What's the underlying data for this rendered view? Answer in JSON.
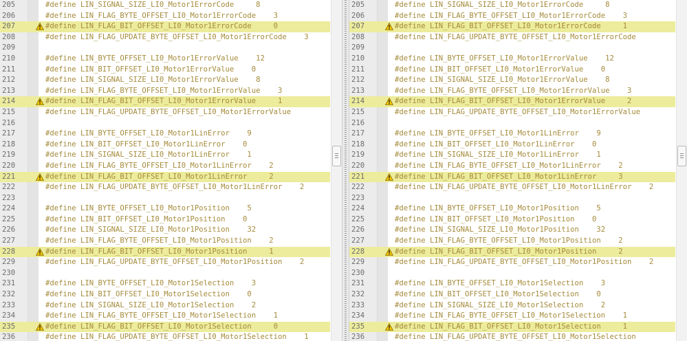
{
  "colors": {
    "changed_bg": "#ecec9c",
    "code": "#a58b3b",
    "line_number": "#6d6d6d",
    "gutter": "#ececec"
  },
  "icons": {
    "change_marker": "warning-icon"
  },
  "left": {
    "lines": [
      {
        "num": "205",
        "code": "#define LIN_SIGNAL_SIZE_LI0_Motor1ErrorCode     8",
        "changed": false
      },
      {
        "num": "206",
        "code": "#define LIN_FLAG_BYTE_OFFSET_LI0_Motor1ErrorCode    3",
        "changed": false
      },
      {
        "num": "207",
        "code": "#define LIN_FLAG_BIT_OFFSET_LI0_Motor1ErrorCode     0",
        "changed": true
      },
      {
        "num": "208",
        "code": "#define LIN_FLAG_UPDATE_BYTE_OFFSET_LI0_Motor1ErrorCode    3",
        "changed": false
      },
      {
        "num": "209",
        "code": "",
        "changed": false
      },
      {
        "num": "210",
        "code": "#define LIN_BYTE_OFFSET_LI0_Motor1ErrorValue    12",
        "changed": false
      },
      {
        "num": "211",
        "code": "#define LIN_BIT_OFFSET_LI0_Motor1ErrorValue    0",
        "changed": false
      },
      {
        "num": "212",
        "code": "#define LIN_SIGNAL_SIZE_LI0_Motor1ErrorValue    8",
        "changed": false
      },
      {
        "num": "213",
        "code": "#define LIN_FLAG_BYTE_OFFSET_LI0_Motor1ErrorValue    3",
        "changed": false
      },
      {
        "num": "214",
        "code": "#define LIN_FLAG_BIT_OFFSET_LI0_Motor1ErrorValue     1",
        "changed": true
      },
      {
        "num": "215",
        "code": "#define LIN_FLAG_UPDATE_BYTE_OFFSET_LI0_Motor1ErrorValue",
        "changed": false
      },
      {
        "num": "216",
        "code": "",
        "changed": false
      },
      {
        "num": "217",
        "code": "#define LIN_BYTE_OFFSET_LI0_Motor1LinError    9",
        "changed": false
      },
      {
        "num": "218",
        "code": "#define LIN_BIT_OFFSET_LI0_Motor1LinError    0",
        "changed": false
      },
      {
        "num": "219",
        "code": "#define LIN_SIGNAL_SIZE_LI0_Motor1LinError    1",
        "changed": false
      },
      {
        "num": "220",
        "code": "#define LIN_FLAG_BYTE_OFFSET_LI0_Motor1LinError    2",
        "changed": false
      },
      {
        "num": "221",
        "code": "#define LIN_FLAG_BIT_OFFSET_LI0_Motor1LinError     2",
        "changed": true
      },
      {
        "num": "222",
        "code": "#define LIN_FLAG_UPDATE_BYTE_OFFSET_LI0_Motor1LinError    2",
        "changed": false
      },
      {
        "num": "223",
        "code": "",
        "changed": false
      },
      {
        "num": "224",
        "code": "#define LIN_BYTE_OFFSET_LI0_Motor1Position    5",
        "changed": false
      },
      {
        "num": "225",
        "code": "#define LIN_BIT_OFFSET_LI0_Motor1Position    0",
        "changed": false
      },
      {
        "num": "226",
        "code": "#define LIN_SIGNAL_SIZE_LI0_Motor1Position    32",
        "changed": false
      },
      {
        "num": "227",
        "code": "#define LIN_FLAG_BYTE_OFFSET_LI0_Motor1Position    2",
        "changed": false
      },
      {
        "num": "228",
        "code": "#define LIN_FLAG_BIT_OFFSET_LI0_Motor1Position     1",
        "changed": true
      },
      {
        "num": "229",
        "code": "#define LIN_FLAG_UPDATE_BYTE_OFFSET_LI0_Motor1Position    2",
        "changed": false
      },
      {
        "num": "230",
        "code": "",
        "changed": false
      },
      {
        "num": "231",
        "code": "#define LIN_BYTE_OFFSET_LI0_Motor1Selection    3",
        "changed": false
      },
      {
        "num": "232",
        "code": "#define LIN_BIT_OFFSET_LI0_Motor1Selection    0",
        "changed": false
      },
      {
        "num": "233",
        "code": "#define LIN_SIGNAL_SIZE_LI0_Motor1Selection    2",
        "changed": false
      },
      {
        "num": "234",
        "code": "#define LIN_FLAG_BYTE_OFFSET_LI0_Motor1Selection    1",
        "changed": false
      },
      {
        "num": "235",
        "code": "#define LIN_FLAG_BIT_OFFSET_LI0_Motor1Selection     0",
        "changed": true
      },
      {
        "num": "236",
        "code": "#define LIN_FLAG_UPDATE_BYTE_OFFSET_LI0_Motor1Selection    1",
        "changed": false
      }
    ]
  },
  "right": {
    "lines": [
      {
        "num": "205",
        "code": "#define LIN_SIGNAL_SIZE_LI0_Motor1ErrorCode     8",
        "changed": false
      },
      {
        "num": "206",
        "code": "#define LIN_FLAG_BYTE_OFFSET_LI0_Motor1ErrorCode    3",
        "changed": false
      },
      {
        "num": "207",
        "code": "#define LIN_FLAG_BIT_OFFSET_LI0_Motor1ErrorCode     1",
        "changed": true
      },
      {
        "num": "208",
        "code": "#define LIN_FLAG_UPDATE_BYTE_OFFSET_LI0_Motor1ErrorCode",
        "changed": false
      },
      {
        "num": "209",
        "code": "",
        "changed": false
      },
      {
        "num": "210",
        "code": "#define LIN_BYTE_OFFSET_LI0_Motor1ErrorValue    12",
        "changed": false
      },
      {
        "num": "211",
        "code": "#define LIN_BIT_OFFSET_LI0_Motor1ErrorValue    0",
        "changed": false
      },
      {
        "num": "212",
        "code": "#define LIN_SIGNAL_SIZE_LI0_Motor1ErrorValue    8",
        "changed": false
      },
      {
        "num": "213",
        "code": "#define LIN_FLAG_BYTE_OFFSET_LI0_Motor1ErrorValue    3",
        "changed": false
      },
      {
        "num": "214",
        "code": "#define LIN_FLAG_BIT_OFFSET_LI0_Motor1ErrorValue     2",
        "changed": true
      },
      {
        "num": "215",
        "code": "#define LIN_FLAG_UPDATE_BYTE_OFFSET_LI0_Motor1ErrorValue",
        "changed": false
      },
      {
        "num": "216",
        "code": "",
        "changed": false
      },
      {
        "num": "217",
        "code": "#define LIN_BYTE_OFFSET_LI0_Motor1LinError    9",
        "changed": false
      },
      {
        "num": "218",
        "code": "#define LIN_BIT_OFFSET_LI0_Motor1LinError    0",
        "changed": false
      },
      {
        "num": "219",
        "code": "#define LIN_SIGNAL_SIZE_LI0_Motor1LinError    1",
        "changed": false
      },
      {
        "num": "220",
        "code": "#define LIN_FLAG_BYTE_OFFSET_LI0_Motor1LinError    2",
        "changed": false
      },
      {
        "num": "221",
        "code": "#define LIN_FLAG_BIT_OFFSET_LI0_Motor1LinError     3",
        "changed": true
      },
      {
        "num": "222",
        "code": "#define LIN_FLAG_UPDATE_BYTE_OFFSET_LI0_Motor1LinError    2",
        "changed": false
      },
      {
        "num": "223",
        "code": "",
        "changed": false
      },
      {
        "num": "224",
        "code": "#define LIN_BYTE_OFFSET_LI0_Motor1Position    5",
        "changed": false
      },
      {
        "num": "225",
        "code": "#define LIN_BIT_OFFSET_LI0_Motor1Position    0",
        "changed": false
      },
      {
        "num": "226",
        "code": "#define LIN_SIGNAL_SIZE_LI0_Motor1Position    32",
        "changed": false
      },
      {
        "num": "227",
        "code": "#define LIN_FLAG_BYTE_OFFSET_LI0_Motor1Position    2",
        "changed": false
      },
      {
        "num": "228",
        "code": "#define LIN_FLAG_BIT_OFFSET_LI0_Motor1Position     2",
        "changed": true
      },
      {
        "num": "229",
        "code": "#define LIN_FLAG_UPDATE_BYTE_OFFSET_LI0_Motor1Position    2",
        "changed": false
      },
      {
        "num": "230",
        "code": "",
        "changed": false
      },
      {
        "num": "231",
        "code": "#define LIN_BYTE_OFFSET_LI0_Motor1Selection    3",
        "changed": false
      },
      {
        "num": "232",
        "code": "#define LIN_BIT_OFFSET_LI0_Motor1Selection    0",
        "changed": false
      },
      {
        "num": "233",
        "code": "#define LIN_SIGNAL_SIZE_LI0_Motor1Selection    2",
        "changed": false
      },
      {
        "num": "234",
        "code": "#define LIN_FLAG_BYTE_OFFSET_LI0_Motor1Selection    1",
        "changed": false
      },
      {
        "num": "235",
        "code": "#define LIN_FLAG_BIT_OFFSET_LI0_Motor1Selection     1",
        "changed": true
      },
      {
        "num": "236",
        "code": "#define LIN_FLAG_UPDATE_BYTE_OFFSET_LI0_Motor1Selection",
        "changed": false
      }
    ]
  }
}
